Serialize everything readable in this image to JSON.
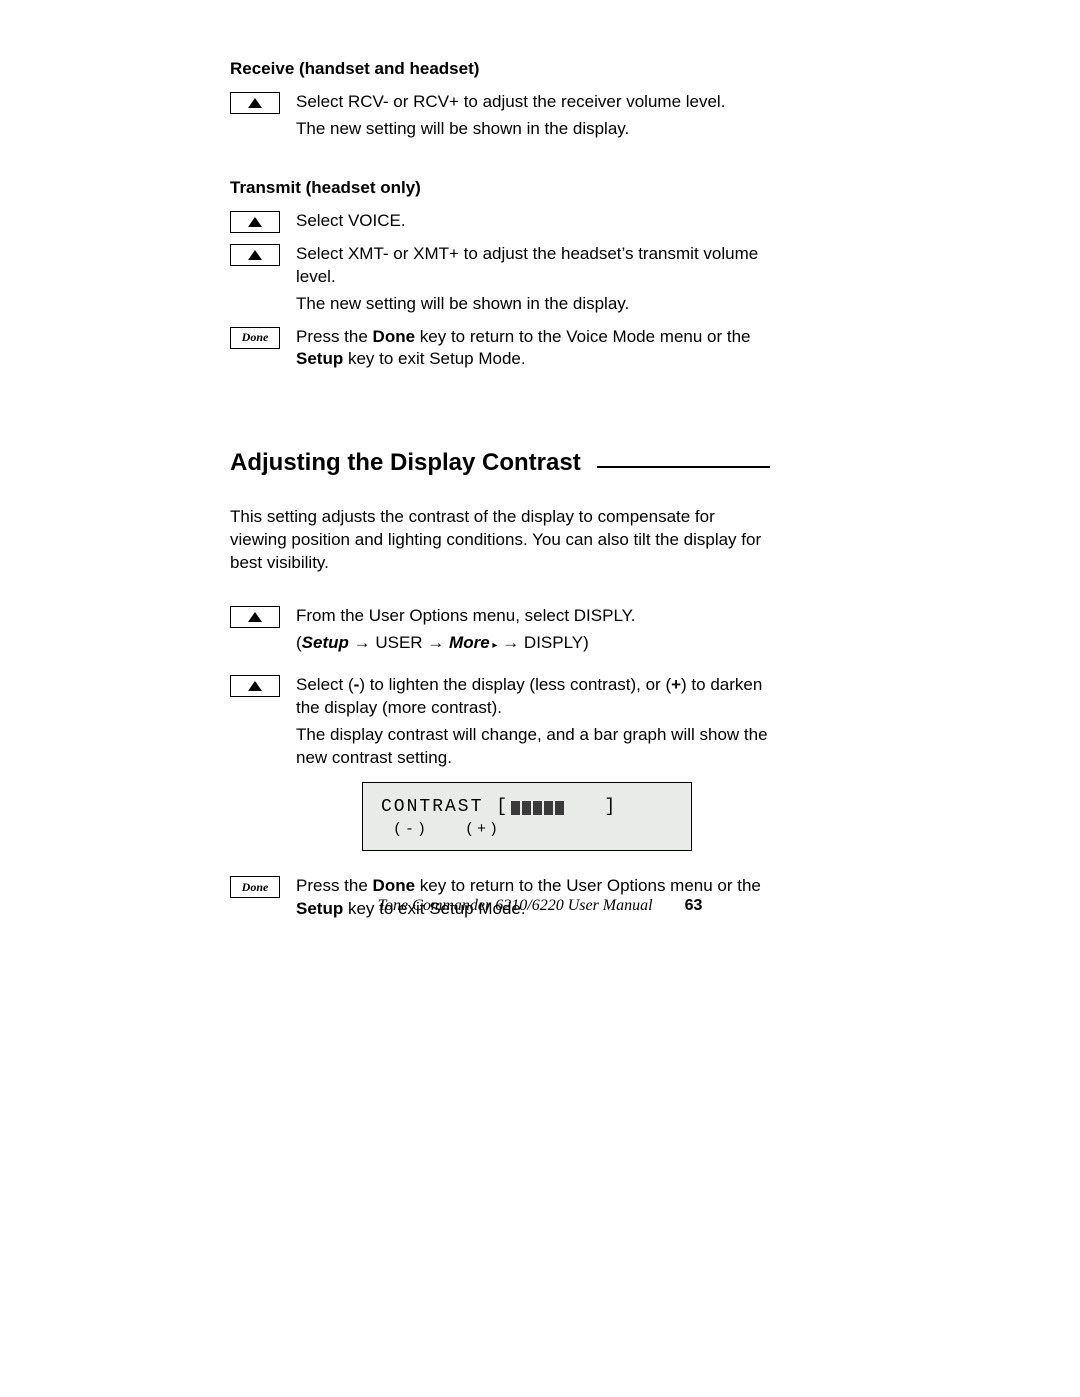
{
  "section1": {
    "heading": "Receive (handset and headset)",
    "step1a": "Select RCV- or RCV+ to adjust the receiver volume level.",
    "step1b": "The new setting will be shown in the display."
  },
  "section2": {
    "heading": "Transmit (headset only)",
    "step1": "Select VOICE.",
    "step2a": "Select XMT- or XMT+ to adjust the headset’s transmit volume level.",
    "step2b": "The new setting will be shown in the display.",
    "step3_pre": "Press the ",
    "step3_b1": "Done",
    "step3_mid1": " key to return to the Voice Mode menu or the ",
    "step3_b2": "Setup",
    "step3_mid2": " key to exit Setup Mode."
  },
  "section3": {
    "title": "Adjusting the Display Contrast",
    "intro": "This setting adjusts the contrast of the display to compensate for viewing position and lighting conditions. You can also tilt the display for best visibility.",
    "step1a": "From the User Options menu, select DISPLY.",
    "step1b_open": "(",
    "step1b_b1": "Setup",
    "step1b_mid1": " → USER → ",
    "step1b_b2": "More",
    "step1b_tri": " ▸",
    "step1b_mid2": " → DISPLY)",
    "step2a_pre": "Select (",
    "step2a_b1": "-",
    "step2a_mid1": ") to lighten the display (less contrast), or (",
    "step2a_b2": "+",
    "step2a_mid2": ") to darken the display (more contrast).",
    "step2b": "The display contrast will change, and a bar graph will show the new contrast setting.",
    "lcd_line1_left": "CONTRAST [",
    "lcd_line1_right": "   ]",
    "lcd_bar_count": 5,
    "lcd_line2": " (-)   (+)",
    "step3_pre": "Press the ",
    "step3_b1": "Done",
    "step3_mid1": " key to return to the User Options menu or the ",
    "step3_b2": "Setup",
    "step3_mid2": " key to exit Setup Mode."
  },
  "keys": {
    "done": "Done"
  },
  "footer": {
    "text": "Tone Commander 6210/6220 User Manual",
    "page": "63"
  }
}
